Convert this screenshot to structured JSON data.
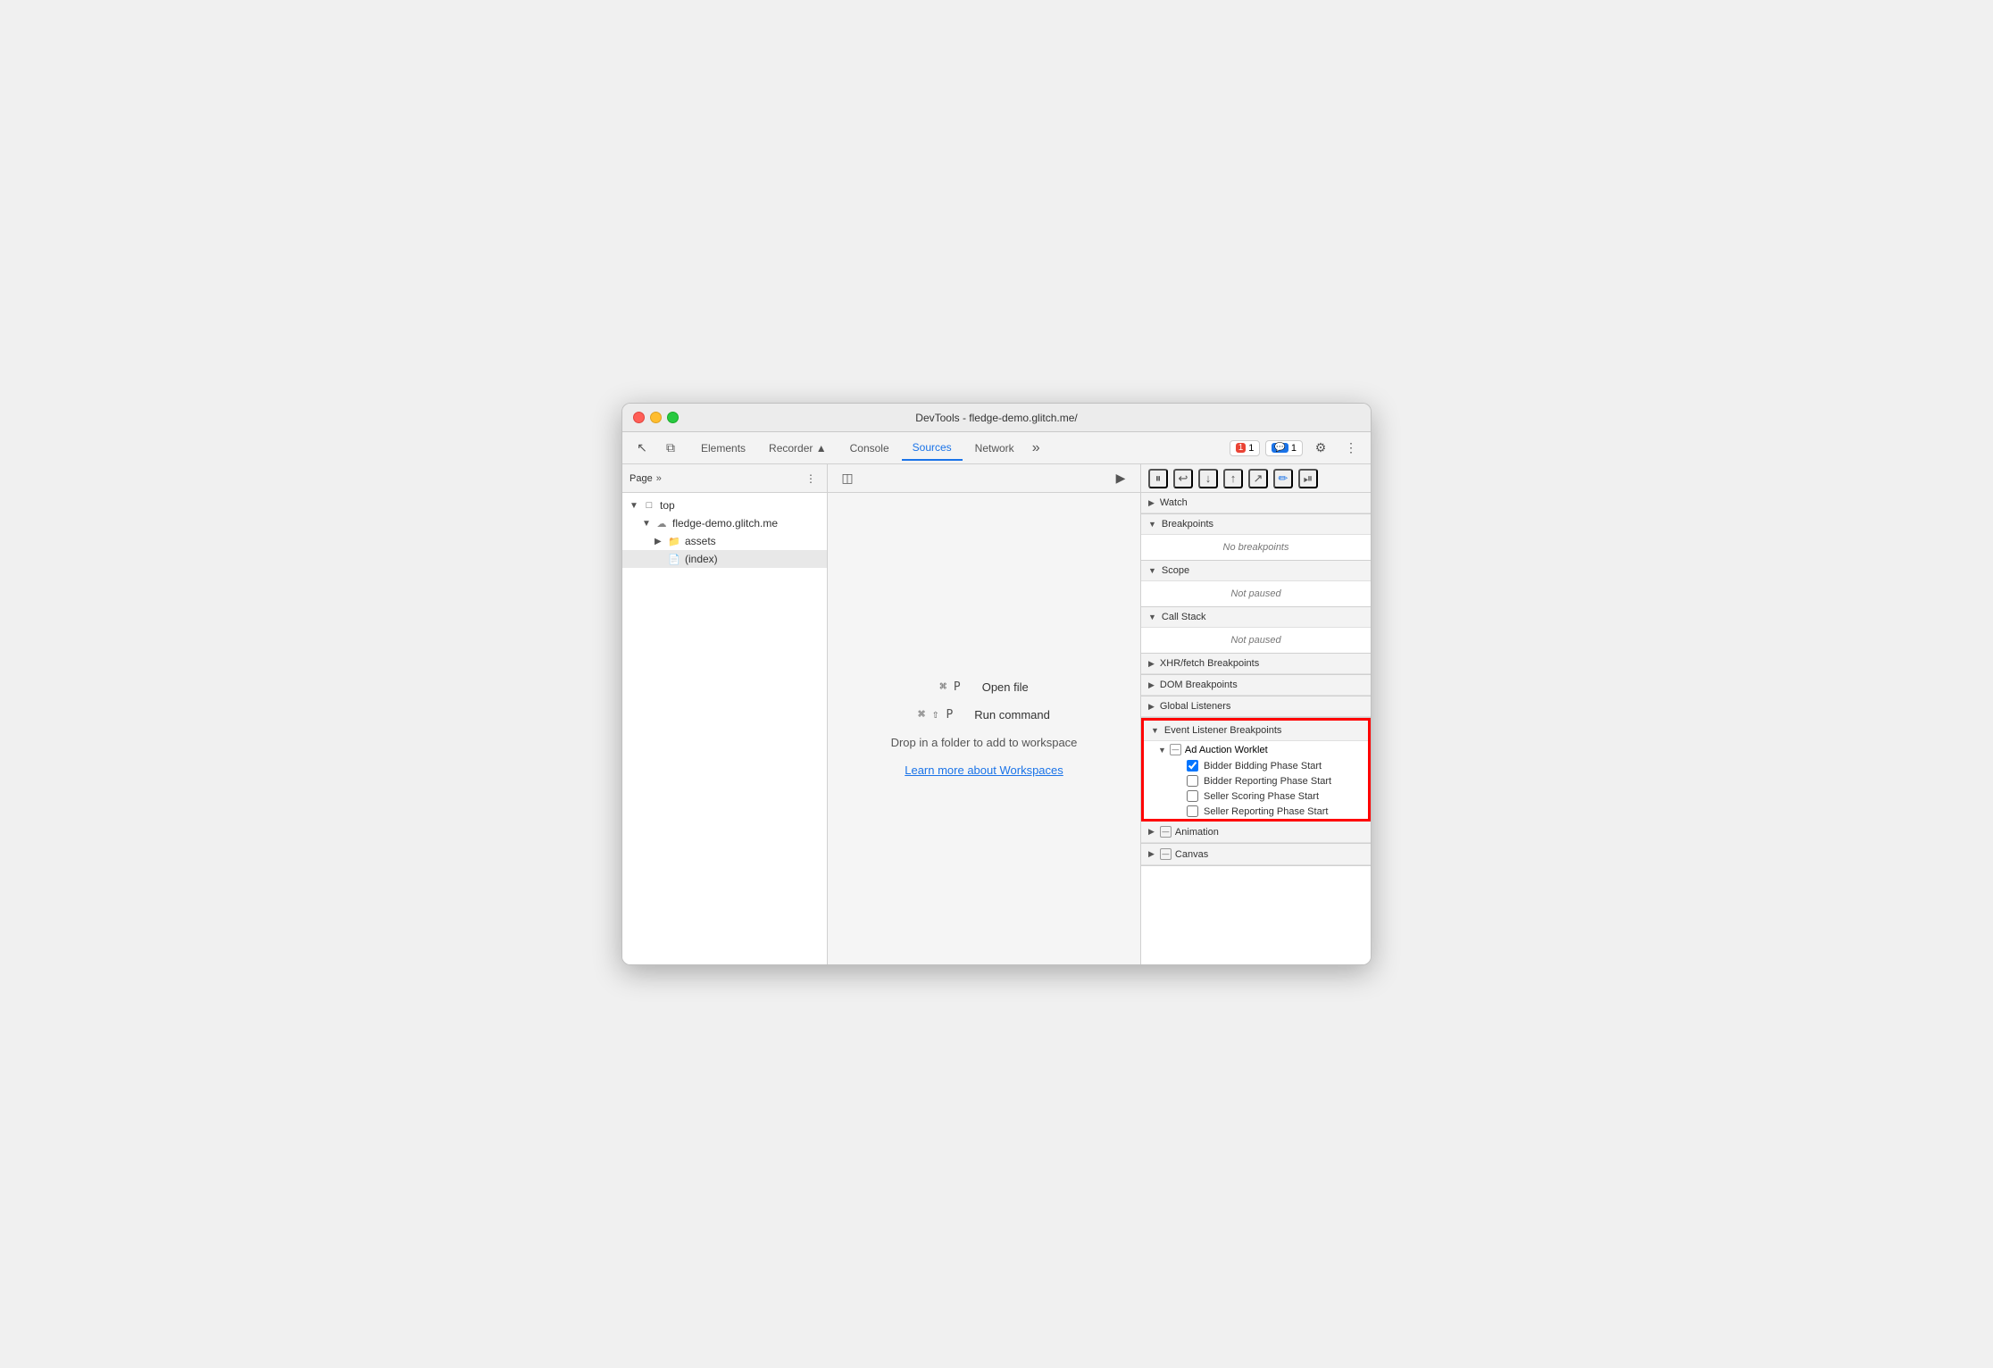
{
  "window": {
    "title": "DevTools - fledge-demo.glitch.me/"
  },
  "tabs": {
    "items": [
      {
        "label": "Elements",
        "active": false
      },
      {
        "label": "Recorder ▲",
        "active": false
      },
      {
        "label": "Console",
        "active": false
      },
      {
        "label": "Sources",
        "active": true
      },
      {
        "label": "Network",
        "active": false
      }
    ],
    "more_label": "»",
    "errors_badge": "1",
    "messages_badge": "1"
  },
  "left_panel": {
    "title": "Page",
    "more_label": "»",
    "tree": [
      {
        "label": "top",
        "level": 0,
        "arrow": "▼",
        "icon": "folder"
      },
      {
        "label": "fledge-demo.glitch.me",
        "level": 1,
        "arrow": "▼",
        "icon": "cloud"
      },
      {
        "label": "assets",
        "level": 2,
        "arrow": "▶",
        "icon": "folder"
      },
      {
        "label": "(index)",
        "level": 2,
        "arrow": "",
        "icon": "file",
        "selected": true
      }
    ]
  },
  "editor": {
    "shortcuts": [
      {
        "key": "⌘ P",
        "label": "Open file"
      },
      {
        "key": "⌘ ⇧ P",
        "label": "Run command"
      }
    ],
    "workspace_text": "Drop in a folder to add to workspace",
    "workspace_link": "Learn more about Workspaces"
  },
  "right_panel": {
    "sections": [
      {
        "id": "watch",
        "title": "Watch",
        "collapsed": true,
        "content": null
      },
      {
        "id": "breakpoints",
        "title": "Breakpoints",
        "collapsed": false,
        "content": "No breakpoints"
      },
      {
        "id": "scope",
        "title": "Scope",
        "collapsed": false,
        "content": "Not paused"
      },
      {
        "id": "call_stack",
        "title": "Call Stack",
        "collapsed": false,
        "content": "Not paused"
      },
      {
        "id": "xhr_fetch",
        "title": "XHR/fetch Breakpoints",
        "collapsed": true,
        "content": null
      },
      {
        "id": "dom_breakpoints",
        "title": "DOM Breakpoints",
        "collapsed": true,
        "content": null
      },
      {
        "id": "global_listeners",
        "title": "Global Listeners",
        "collapsed": true,
        "content": null
      },
      {
        "id": "event_listener_breakpoints",
        "title": "Event Listener Breakpoints",
        "collapsed": false,
        "highlighted": true
      },
      {
        "id": "animation",
        "title": "Animation",
        "collapsed": true,
        "content": null
      },
      {
        "id": "canvas",
        "title": "Canvas",
        "collapsed": true,
        "content": null
      }
    ],
    "ad_auction": {
      "title": "Ad Auction Worklet",
      "items": [
        {
          "label": "Bidder Bidding Phase Start",
          "checked": true
        },
        {
          "label": "Bidder Reporting Phase Start",
          "checked": false
        },
        {
          "label": "Seller Scoring Phase Start",
          "checked": false
        },
        {
          "label": "Seller Reporting Phase Start",
          "checked": false
        }
      ]
    }
  },
  "debugger_toolbar": {
    "buttons": [
      "⏸",
      "↩",
      "↓",
      "↑",
      "↗",
      "✏️",
      "⏯"
    ]
  },
  "icons": {
    "cursor": "↖",
    "layers": "⧉",
    "more_vertical": "⋮",
    "more_horiz": "»",
    "gear": "⚙",
    "menu": "⋮",
    "sidebar_left": "◫",
    "play_pause": "⏵"
  }
}
